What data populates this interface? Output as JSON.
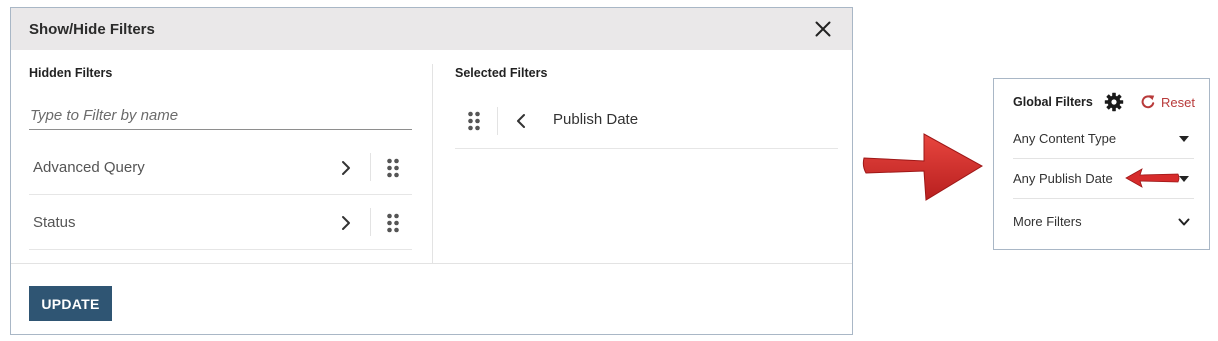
{
  "dialog": {
    "title": "Show/Hide Filters",
    "hidden_heading": "Hidden Filters",
    "filter_placeholder": "Type to Filter by name",
    "hidden_filters": [
      {
        "label": "Advanced Query"
      },
      {
        "label": "Status"
      }
    ],
    "selected_heading": "Selected Filters",
    "selected_filters": [
      {
        "label": "Publish Date"
      }
    ],
    "update_label": "UPDATE"
  },
  "global_filters": {
    "title": "Global Filters",
    "reset_label": "Reset",
    "items": [
      {
        "label": "Any Content Type"
      },
      {
        "label": "Any Publish Date"
      },
      {
        "label": "More Filters"
      }
    ]
  },
  "icons": {
    "close": "close-icon",
    "chevron_right": "chevron-right-icon",
    "chevron_left": "chevron-left-icon",
    "drag": "drag-handle-icon",
    "gear": "gear-icon",
    "reset": "refresh-icon",
    "caret": "caret-down-icon",
    "chevron_down": "chevron-down-icon"
  },
  "colors": {
    "update_button": "#2f5573",
    "header_bg": "#eae8e9",
    "reset": "#b83a3a",
    "arrow": "#d62b2b",
    "panel_border": "#a9b7c6"
  }
}
